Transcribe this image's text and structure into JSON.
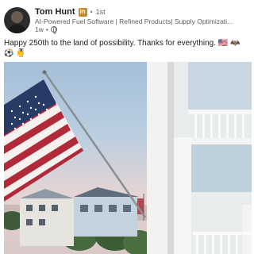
{
  "post": {
    "author": {
      "name": "Tom Hunt",
      "badge": "in",
      "connection_degree": "1st",
      "headline": "AI-Powered Fuel Software | Refined Products| Supply Optimizati...",
      "timestamp": "1w"
    },
    "text": "Happy 250th to the land of possibility. Thanks for everything. 🇺🇸 🦇 😂 🎖",
    "text_line2_emoji": [
      "⚽",
      "👏"
    ],
    "separator_dot": "•",
    "icons": {
      "visibility": "globe-icon"
    }
  }
}
